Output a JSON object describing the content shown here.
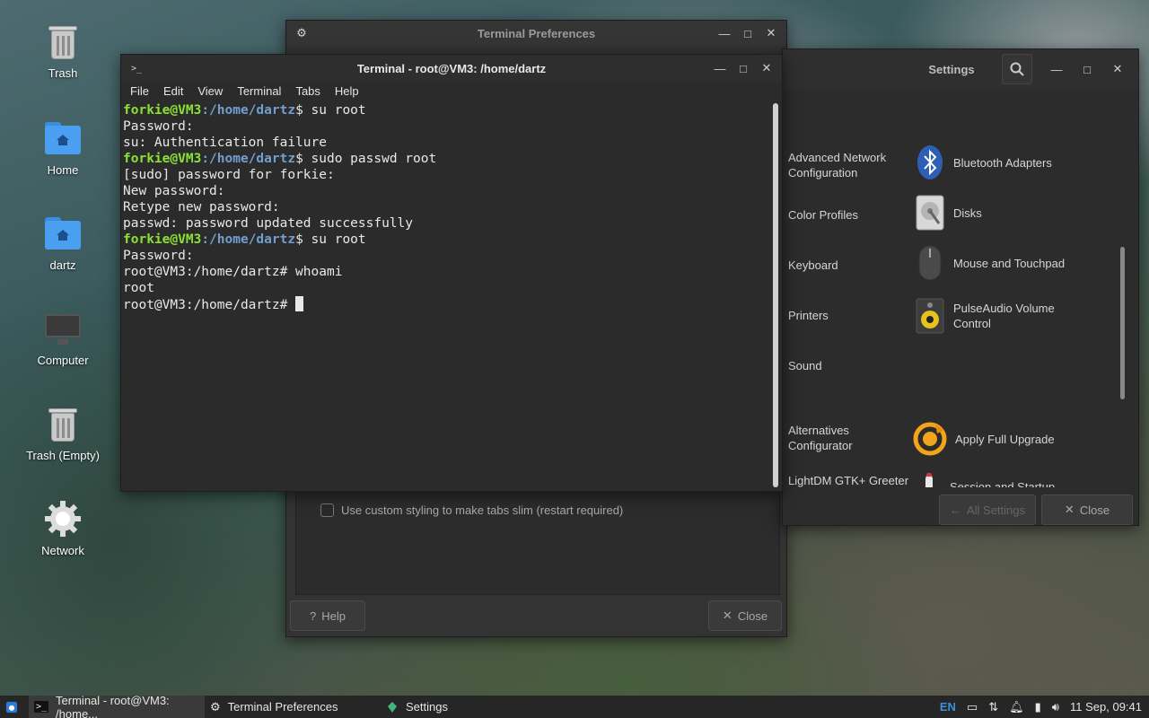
{
  "desktop": {
    "icons": [
      {
        "label": "Trash"
      },
      {
        "label": "Home"
      },
      {
        "label": "dartz"
      },
      {
        "label": "Computer"
      },
      {
        "label": "Trash (Empty)"
      },
      {
        "label": "Network"
      }
    ]
  },
  "prefs_window": {
    "title": "Terminal Preferences",
    "checkbox_label": "Use custom styling to make tabs slim (restart required)",
    "help_label": "Help",
    "close_label": "Close"
  },
  "settings_window": {
    "title": "Settings",
    "items": [
      {
        "label": "Advanced Network Configuration",
        "icon": "network-icon"
      },
      {
        "label": "Bluetooth Adapters",
        "icon": "bluetooth-icon"
      },
      {
        "label": "Color Profiles",
        "icon": "color-icon"
      },
      {
        "label": "Disks",
        "icon": "disks-icon"
      },
      {
        "label": "Keyboard",
        "icon": "keyboard-icon"
      },
      {
        "label": "Mouse and Touchpad",
        "icon": "mouse-icon"
      },
      {
        "label": "Printers",
        "icon": "printer-icon"
      },
      {
        "label": "PulseAudio Volume Control",
        "icon": "speaker-icon"
      },
      {
        "label": "Sound",
        "icon": "sound-icon"
      },
      {
        "label": "Alternatives Configurator",
        "icon": "alternatives-icon"
      },
      {
        "label": "Apply Full Upgrade",
        "icon": "upgrade-icon"
      },
      {
        "label": "LightDM GTK+ Greeter",
        "icon": "greeter-icon"
      },
      {
        "label": "Session and Startup",
        "icon": "rocket-icon"
      }
    ],
    "all_settings_label": "All Settings",
    "close_label": "Close"
  },
  "terminal_window": {
    "title": "Terminal - root@VM3: /home/dartz",
    "menu": [
      "File",
      "Edit",
      "View",
      "Terminal",
      "Tabs",
      "Help"
    ],
    "lines": [
      {
        "user": "forkie@VM3",
        "path": ":/home/dartz",
        "cmd": "$ su root"
      },
      {
        "text": "Password:"
      },
      {
        "text": "su: Authentication failure"
      },
      {
        "user": "forkie@VM3",
        "path": ":/home/dartz",
        "cmd": "$ sudo passwd root"
      },
      {
        "text": "[sudo] password for forkie:"
      },
      {
        "text": "New password:"
      },
      {
        "text": "Retype new password:"
      },
      {
        "text": "passwd: password updated successfully"
      },
      {
        "user": "forkie@VM3",
        "path": ":/home/dartz",
        "cmd": "$ su root"
      },
      {
        "text": "Password:"
      },
      {
        "text": "root@VM3:/home/dartz# whoami"
      },
      {
        "text": "root"
      },
      {
        "text": "root@VM3:/home/dartz# "
      }
    ]
  },
  "taskbar": {
    "tasks": [
      {
        "label": "Terminal - root@VM3: /home...",
        "icon": "terminal-icon"
      },
      {
        "label": "Terminal Preferences",
        "icon": "gear-icon"
      },
      {
        "label": "Settings",
        "icon": "settings-icon"
      }
    ],
    "lang": "EN",
    "clock": "11 Sep, 09:41"
  }
}
